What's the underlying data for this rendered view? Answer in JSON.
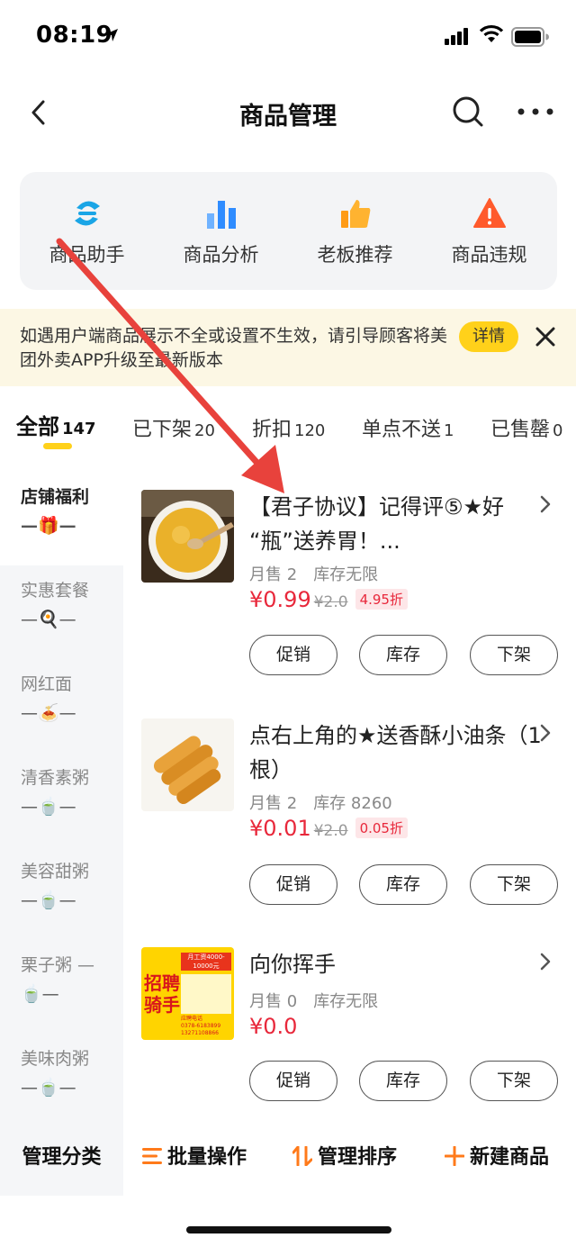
{
  "status_bar": {
    "time": "08:19"
  },
  "nav": {
    "title": "商品管理",
    "back_icon": "chevron-left-icon",
    "search_icon": "search-icon",
    "more_icon": "more-icon"
  },
  "tools": [
    {
      "label": "商品助手",
      "icon": "assistant-icon",
      "color": "#1aa5e6"
    },
    {
      "label": "商品分析",
      "icon": "bar-chart-icon",
      "color": "#2f8cff"
    },
    {
      "label": "老板推荐",
      "icon": "thumbs-up-icon",
      "color": "#ffa51f"
    },
    {
      "label": "商品违规",
      "icon": "warning-icon",
      "color": "#ff5a2c"
    }
  ],
  "notice": {
    "text": "如遇用户端商品展示不全或设置不生效，请引导顾客将美团外卖APP升级至最新版本",
    "detail_label": "详情",
    "close_icon": "close-icon"
  },
  "tabs": [
    {
      "label": "全部",
      "count": "147",
      "active": true
    },
    {
      "label": "已下架",
      "count": "20"
    },
    {
      "label": "折扣",
      "count": "120"
    },
    {
      "label": "单点不送",
      "count": "1"
    },
    {
      "label": "已售罄",
      "count": "0"
    }
  ],
  "sidebar": [
    {
      "label": "店铺福利",
      "suffix": "🎁—",
      "prefix": "—",
      "active": true
    },
    {
      "label": "实惠套餐",
      "prefix": "—",
      "suffix": "🍳—"
    },
    {
      "label": "网红面",
      "prefix": "—",
      "suffix": "🍝—"
    },
    {
      "label": "清香素粥",
      "prefix": "—",
      "suffix": "🍵—"
    },
    {
      "label": "美容甜粥",
      "prefix": "—",
      "suffix": "🍵—"
    },
    {
      "label": "栗子粥 —",
      "prefix": "",
      "suffix": "🍵—"
    },
    {
      "label": "美味肉粥",
      "prefix": "—",
      "suffix": "🍵—"
    }
  ],
  "products": [
    {
      "name": "【君子协议】记得评⑤★好 “瓶”送养胃！...",
      "sales": "月售 2",
      "stock": "库存无限",
      "price": "¥0.99",
      "original_price": "¥2.0",
      "discount": "4.95折",
      "image": "millet-porridge-image"
    },
    {
      "name": "点右上角的★送香酥小油条（1根）",
      "sales": "月售 2",
      "stock": "库存 8260",
      "price": "¥0.01",
      "original_price": "¥2.0",
      "discount": "0.05折",
      "image": "fried-dough-sticks-image"
    },
    {
      "name": "向你挥手",
      "sales": "月售 0",
      "stock": "库存无限",
      "price": "¥0.0",
      "original_price": "",
      "discount": "",
      "image": "rider-recruitment-poster-image",
      "poster": {
        "title": "招聘骑手",
        "salary": "月工资4000-10000元",
        "phone_label": "应聘电话",
        "phone1": "0378-6183899",
        "phone2": "13271108866"
      }
    }
  ],
  "product_actions": {
    "promo": "促销",
    "stock": "库存",
    "offline": "下架"
  },
  "bottom_bar": {
    "manage_category": "管理分类",
    "batch": "批量操作",
    "sort": "管理排序",
    "new_product": "新建商品",
    "accent": "#ff7a1a"
  },
  "annotation": {
    "color": "#e8423c"
  }
}
